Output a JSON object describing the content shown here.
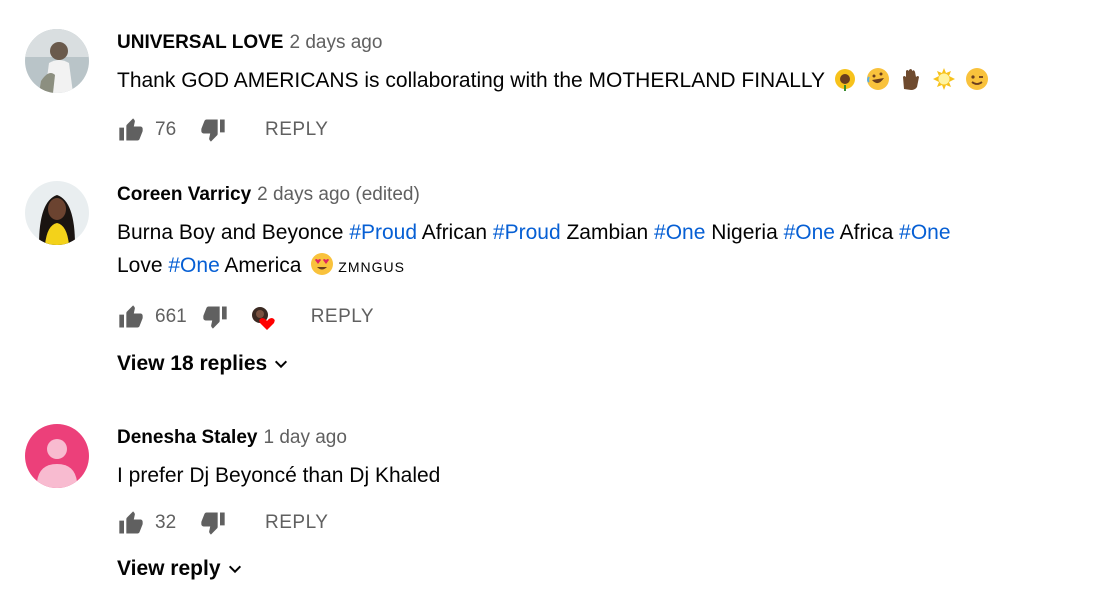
{
  "comments": [
    {
      "author": "UNIVERSAL LOVE",
      "time": "2 days ago",
      "text_plain": "Thank GOD AMERICANS is collaborating with the MOTHERLAND FINALLY",
      "likes": "76",
      "reply_label": "REPLY"
    },
    {
      "author": "Coreen Varricy",
      "time": "2 days ago (edited)",
      "segments": [
        "Burna Boy and Beyonce ",
        "#Proud",
        " African ",
        "#Proud",
        " Zambian ",
        "#One",
        " Nigeria ",
        "#One",
        " Africa ",
        "#One"
      ],
      "segments2": [
        "Love ",
        "#One",
        " America "
      ],
      "badge": "ZMNGUS",
      "likes": "661",
      "reply_label": "REPLY",
      "view_replies": "View 18 replies"
    },
    {
      "author": "Denesha Staley",
      "time": "1 day ago",
      "text_plain": "I prefer Dj Beyoncé than Dj Khaled",
      "likes": "32",
      "reply_label": "REPLY",
      "view_replies": "View reply"
    }
  ],
  "colors": {
    "hashtag": "#065fd4",
    "meta": "#606060",
    "text": "#030303",
    "default_avatar": "#ec407a"
  },
  "icons": [
    "like-icon",
    "dislike-icon",
    "creator-heart-icon",
    "chevron-down-icon"
  ]
}
